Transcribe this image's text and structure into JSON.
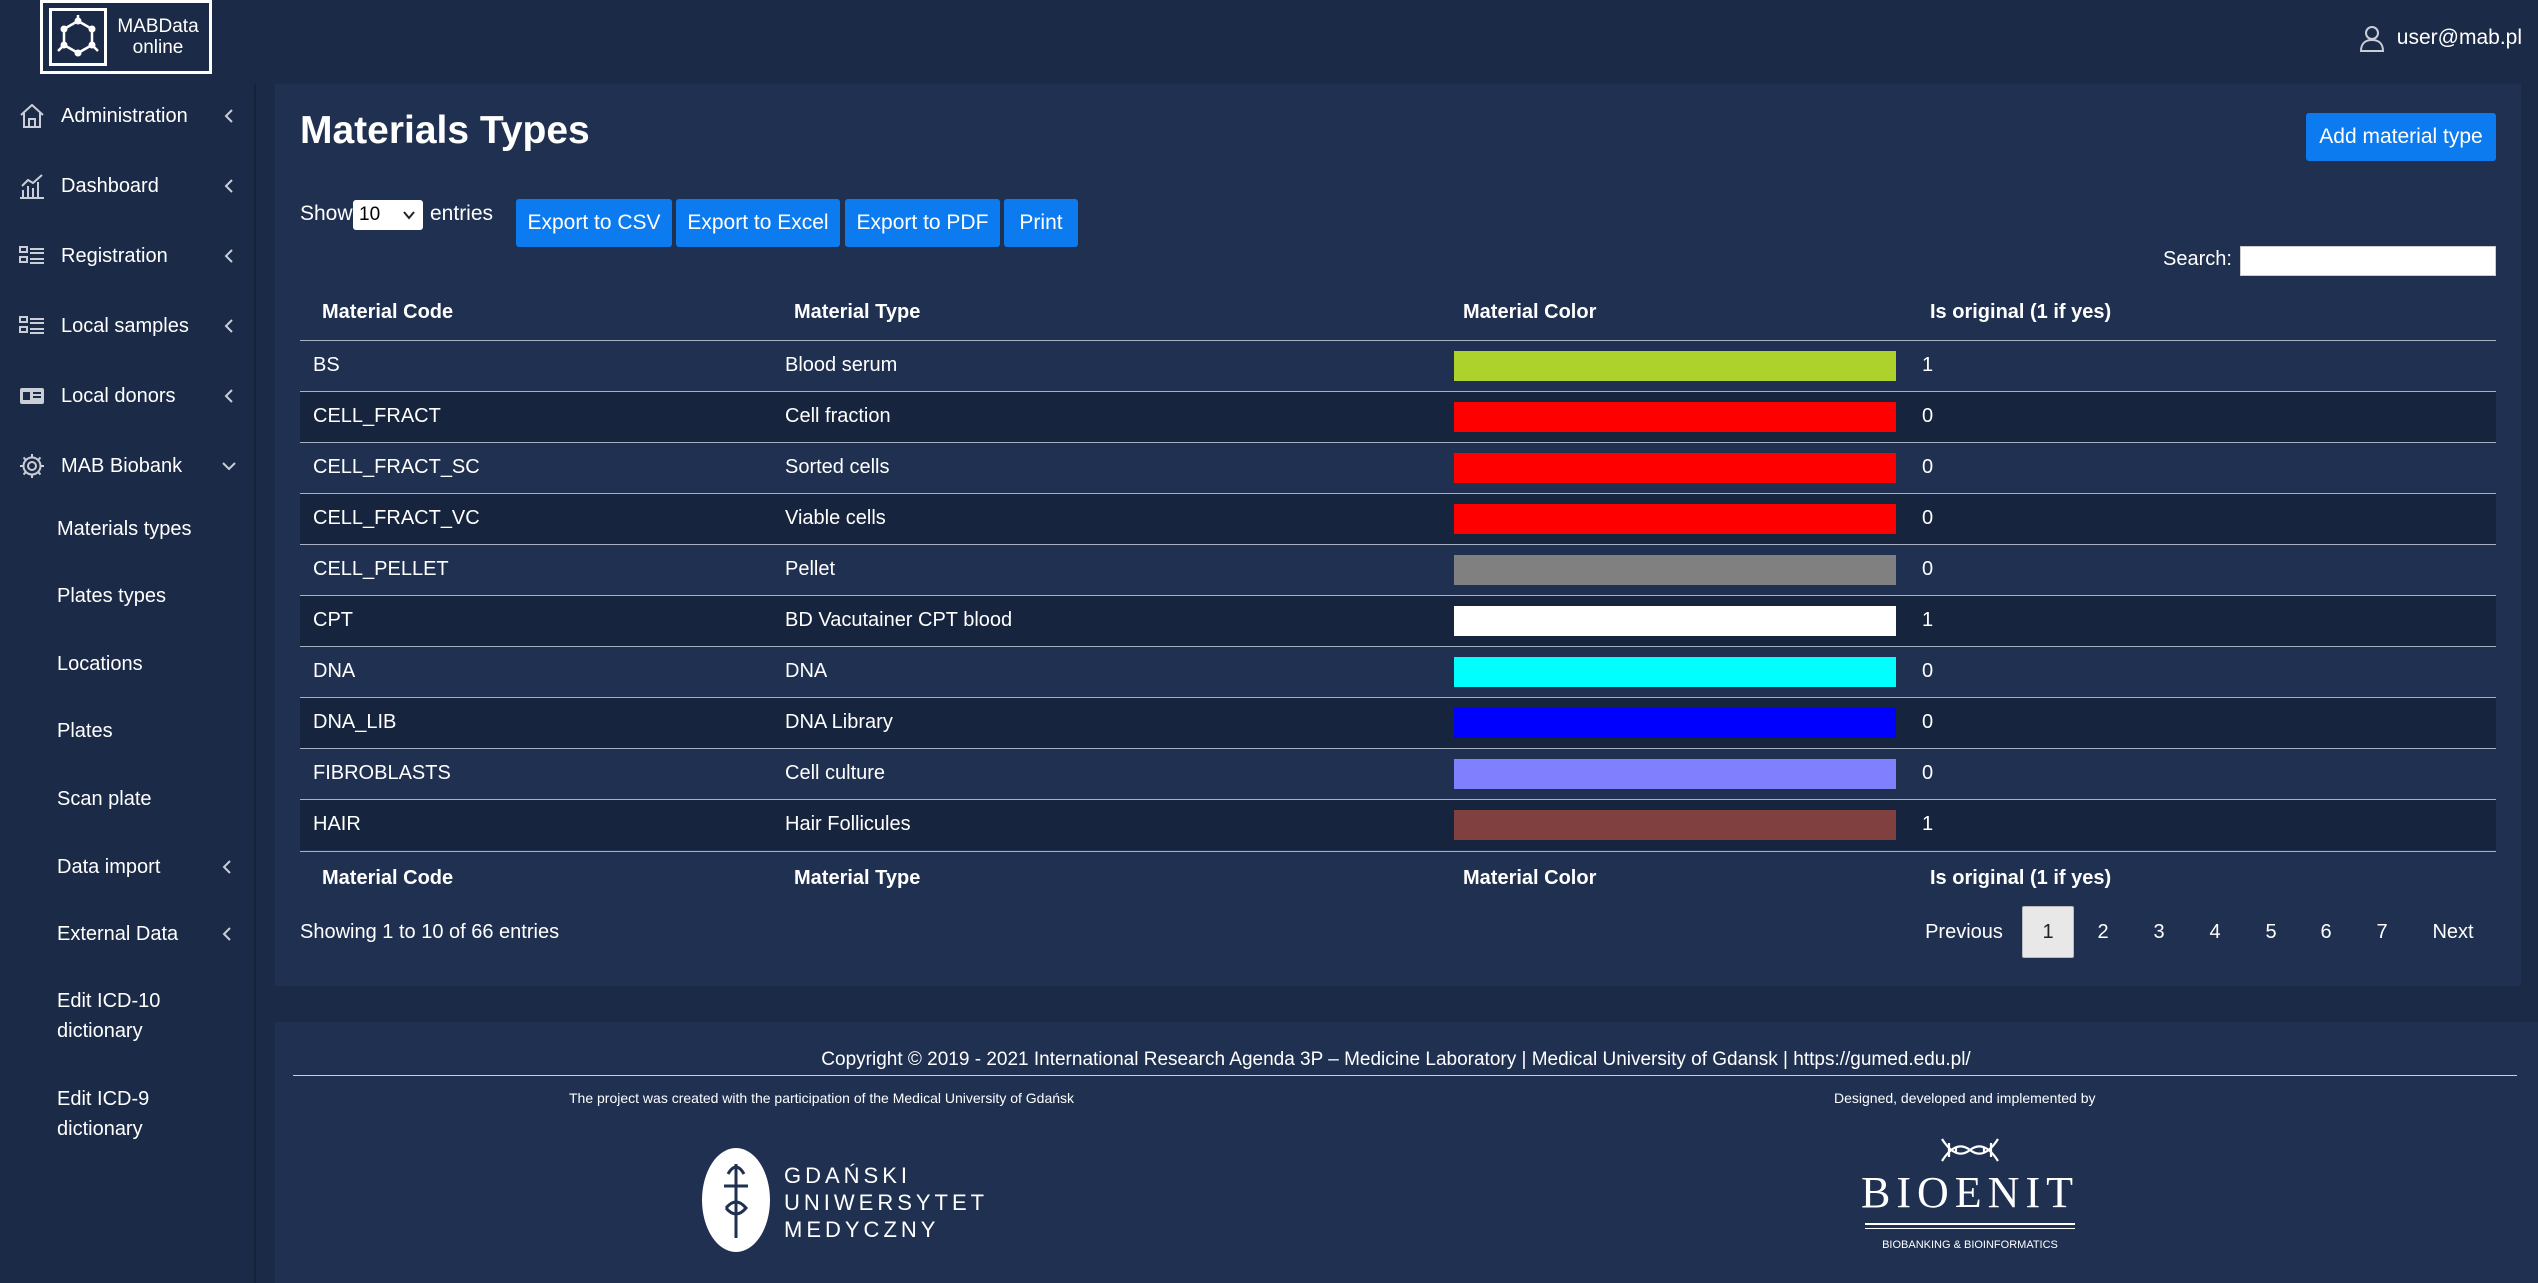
{
  "brand": {
    "logo_line1": "MABData",
    "logo_line2": "online"
  },
  "user": {
    "email": "user@mab.pl",
    "icon": "user-icon"
  },
  "sidebar": {
    "items": [
      {
        "label": "Administration",
        "icon": "home-icon"
      },
      {
        "label": "Dashboard",
        "icon": "chart-icon"
      },
      {
        "label": "Registration",
        "icon": "list-icon"
      },
      {
        "label": "Local samples",
        "icon": "list-icon"
      },
      {
        "label": "Local donors",
        "icon": "id-card-icon"
      },
      {
        "label": "MAB Biobank",
        "icon": "gear-icon"
      }
    ],
    "subitems": [
      "Materials types",
      "Plates types",
      "Locations",
      "Plates",
      "Scan plate",
      "Data import",
      "External Data",
      "Edit ICD-10 dictionary",
      "Edit ICD-9 dictionary"
    ]
  },
  "main": {
    "title": "Materials Types",
    "add_button": "Add material type",
    "show_label": "Show",
    "entries_value": "10",
    "entries_label": "entries",
    "export_buttons": [
      "Export to CSV",
      "Export to Excel",
      "Export to PDF",
      "Print"
    ],
    "search_label": "Search:",
    "search_value": "",
    "columns": [
      "Material Code",
      "Material Type",
      "Material Color",
      "Is original (1 if yes)"
    ],
    "rows": [
      {
        "code": "BS",
        "type": "Blood serum",
        "color": "#acd22b",
        "original": "1"
      },
      {
        "code": "CELL_FRACT",
        "type": "Cell fraction",
        "color": "#ff0000",
        "original": "0"
      },
      {
        "code": "CELL_FRACT_SC",
        "type": "Sorted cells",
        "color": "#ff0000",
        "original": "0"
      },
      {
        "code": "CELL_FRACT_VC",
        "type": "Viable cells",
        "color": "#ff0000",
        "original": "0"
      },
      {
        "code": "CELL_PELLET",
        "type": "Pellet",
        "color": "#808080",
        "original": "0"
      },
      {
        "code": "CPT",
        "type": "BD Vacutainer CPT blood",
        "color": "#ffffff",
        "original": "1"
      },
      {
        "code": "DNA",
        "type": "DNA",
        "color": "#00ffff",
        "original": "0"
      },
      {
        "code": "DNA_LIB",
        "type": "DNA Library",
        "color": "#0000ff",
        "original": "0"
      },
      {
        "code": "FIBROBLASTS",
        "type": "Cell culture",
        "color": "#8080ff",
        "original": "0"
      },
      {
        "code": "HAIR",
        "type": "Hair Follicules",
        "color": "#804040",
        "original": "1"
      }
    ],
    "info": "Showing 1 to 10 of 66 entries",
    "pagination": {
      "previous": "Previous",
      "pages": [
        "1",
        "2",
        "3",
        "4",
        "5",
        "6",
        "7"
      ],
      "active": "1",
      "next": "Next"
    }
  },
  "footer": {
    "copyright": "Copyright © 2019 - 2021 International Research Agenda 3P – Medicine Laboratory | Medical University of Gdansk | https://gumed.edu.pl/",
    "left_note": "The project was created with the participation of the Medical University of Gdańsk",
    "right_note": "Designed, developed and implemented by",
    "gumed_line1": "GDAŃSKI",
    "gumed_line2": "UNIWERSYTET",
    "gumed_line3": "MEDYCZNY",
    "bioenit_name": "BIOENIT",
    "bioenit_tagline": "BIOBANKING & BIOINFORMATICS"
  },
  "colors": {
    "background": "#1b2a46",
    "panel": "#1f3050",
    "button": "#0d7bf0"
  }
}
